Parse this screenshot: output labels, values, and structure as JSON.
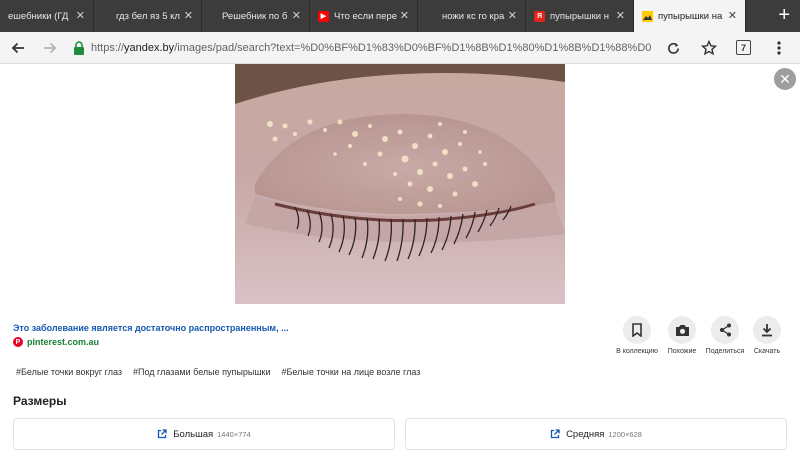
{
  "tabs": [
    {
      "title": "ешебники (ГД",
      "favicon": ""
    },
    {
      "title": "гдз бел яз 5 кл",
      "favicon": ""
    },
    {
      "title": "Решебник по б",
      "favicon": ""
    },
    {
      "title": "Что если пере",
      "favicon": "youtube-icon"
    },
    {
      "title": "ножи кс го кра",
      "favicon": ""
    },
    {
      "title": "пупырышки н",
      "favicon": "yandex-icon",
      "favicon_text": "Я"
    },
    {
      "title": "пупырышки на",
      "favicon": "yandex-images-icon",
      "active": true
    }
  ],
  "toolbar": {
    "url_scheme": "https://",
    "url_host": "yandex.by",
    "url_path": "/images/pad/search?text=%D0%BF%D1%83%D0%BF%D1%8B%D1%80%D1%8B%D1%88%D0%BA%D0%B8%20",
    "tab_count": "7"
  },
  "result": {
    "caption": "Это заболевание является достаточно распространенным, ...",
    "source": "pinterest.com.au",
    "source_icon_text": "P"
  },
  "actions": [
    {
      "label": "В коллекцию",
      "icon": "bookmark-icon"
    },
    {
      "label": "Похожие",
      "icon": "camera-icon"
    },
    {
      "label": "Поделиться",
      "icon": "share-icon"
    },
    {
      "label": "Скачать",
      "icon": "download-icon"
    }
  ],
  "tags": [
    "#Белые точки вокруг глаз",
    "#Под глазами белые пупырышки",
    "#Белые точки на лице возле глаз"
  ],
  "sizes": {
    "title": "Размеры",
    "options": [
      {
        "label": "Большая",
        "dims": "1440×774"
      },
      {
        "label": "Средняя",
        "dims": "1200×628"
      }
    ]
  },
  "colors": {
    "link": "#1558b0",
    "source": "#1a7f37",
    "tabstrip": "#3c3c3c"
  }
}
